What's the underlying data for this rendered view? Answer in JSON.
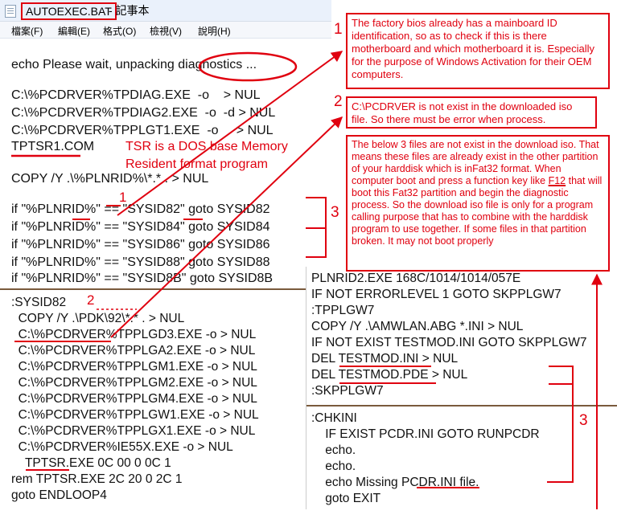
{
  "window": {
    "filename": "AUTOEXEC.BAT",
    "app": "- 記事本"
  },
  "menu": [
    "檔案(F)",
    "編輯(E)",
    "格式(O)",
    "檢視(V)",
    "說明(H)"
  ],
  "left_lines": [
    "echo Please wait, unpacking diagnostics ...",
    "",
    "C:\\%PCDRVER%TPDIAG.EXE  -o    > NUL",
    "C:\\%PCDRVER%TPDIAG2.EXE  -o  -d > NUL",
    "C:\\%PCDRVER%TPPLGT1.EXE  -o     > NUL",
    "TPTSR1.COM",
    "",
    "COPY /Y .\\%PLNRID%\\*.* . > NUL",
    "",
    "if \"%PLNRID%\" == \"SYSID82\" goto SYSID82",
    "if \"%PLNRID%\" == \"SYSID84\" goto SYSID84",
    "if \"%PLNRID%\" == \"SYSID86\" goto SYSID86",
    "if \"%PLNRID%\" == \"SYSID88\" goto SYSID88",
    "if \"%PLNRID%\" == \"SYSID8B\" goto SYSID8B"
  ],
  "bottom_left_lines": [
    ":SYSID82",
    "  COPY /Y .\\PDK\\92\\*.* . > NUL",
    "  C:\\%PCDRVER%TPPLGD3.EXE -o > NUL",
    "  C:\\%PCDRVER%TPPLGA2.EXE -o > NUL",
    "  C:\\%PCDRVER%TPPLGM1.EXE -o > NUL",
    "  C:\\%PCDRVER%TPPLGM2.EXE -o > NUL",
    "  C:\\%PCDRVER%TPPLGM4.EXE -o > NUL",
    "  C:\\%PCDRVER%TPPLGW1.EXE -o > NUL",
    "  C:\\%PCDRVER%TPPLGX1.EXE -o > NUL",
    "  C:\\%PCDRVER%IE55X.EXE -o > NUL",
    "    TPTSR.EXE 0C 00 0 0C 1",
    "rem TPTSR.EXE 2C 20 0 2C 1",
    "goto ENDLOOP4"
  ],
  "right_lines": [
    "PLNRID2.EXE 168C/1014/1014/057E",
    "IF NOT ERRORLEVEL 1 GOTO SKPPLGW7",
    ":TPPLGW7",
    "COPY /Y .\\AMWLAN.ABG *.INI > NUL",
    "IF NOT EXIST TESTMOD.INI GOTO SKPPLGW7",
    "DEL TESTMOD.INI > NUL",
    "DEL TESTMOD.PDE > NUL",
    ":SKPPLGW7"
  ],
  "right_lines2": [
    ":CHKINI",
    "    IF EXIST PCDR.INI GOTO RUNPCDR",
    "    echo.",
    "    echo.",
    "    echo Missing PCDR.INI file.",
    "    goto EXIT"
  ],
  "annotations": {
    "note1": "The factory bios already has a mainboard ID identification, so as to check if this is there motherboard and which motherboard it is. Especially for the purpose of  Windows Activation for their OEM computers.",
    "note2": "C:\\PCDRVER is not exist in the downloaded iso file. So there must be error when process.",
    "note3_pre": "The below 3 files are not exist in the download iso. That means these files are already exist in the other partition of your harddisk which is inFat32 format. When computer boot and press a function key like ",
    "note3_key": "F12",
    "note3_post": " that will boot this Fat32 partition and begin the diagnostic process. So the download iso file is only for a program calling purpose that has to combine with the harddisk program to use together. If some files in that partition broken. It may not boot properly",
    "tsr_note": "TSR is a DOS base Memory\nResident format program",
    "num1": "1",
    "num2": "2",
    "num3": "3"
  },
  "colors": {
    "accent": "#e0000f",
    "divider": "#7a5a3c"
  }
}
